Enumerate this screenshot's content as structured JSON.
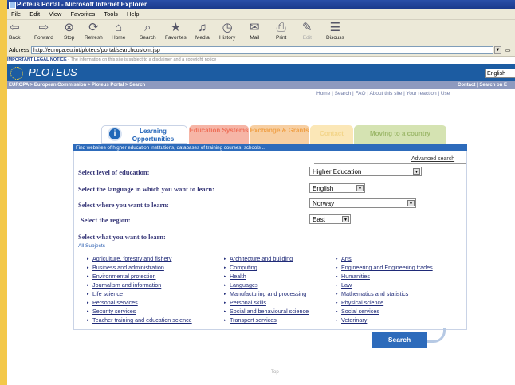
{
  "window": {
    "title": "Ploteus Portal - Microsoft Internet Explorer"
  },
  "menu": [
    "File",
    "Edit",
    "View",
    "Favorites",
    "Tools",
    "Help"
  ],
  "toolbar": [
    {
      "label": "Back",
      "icon": "back-arrow-icon",
      "glyph": "⇦"
    },
    {
      "label": "Forward",
      "icon": "forward-arrow-icon",
      "glyph": "⇨"
    },
    {
      "label": "Stop",
      "icon": "stop-icon",
      "glyph": "⊗"
    },
    {
      "label": "Refresh",
      "icon": "refresh-icon",
      "glyph": "⟳"
    },
    {
      "label": "Home",
      "icon": "home-icon",
      "glyph": "⌂"
    },
    {
      "label": "Search",
      "icon": "search-icon",
      "glyph": "⌕"
    },
    {
      "label": "Favorites",
      "icon": "favorites-icon",
      "glyph": "★"
    },
    {
      "label": "Media",
      "icon": "media-icon",
      "glyph": "♫"
    },
    {
      "label": "History",
      "icon": "history-icon",
      "glyph": "◷"
    },
    {
      "label": "Mail",
      "icon": "mail-icon",
      "glyph": "✉"
    },
    {
      "label": "Print",
      "icon": "print-icon",
      "glyph": "⎙"
    },
    {
      "label": "Edit",
      "icon": "edit-icon",
      "glyph": "✎"
    },
    {
      "label": "Discuss",
      "icon": "discuss-icon",
      "glyph": "☰"
    }
  ],
  "address": {
    "label": "Address",
    "url": "http://europa.eu.int/ploteus/portal/searchcustom.jsp"
  },
  "notice": {
    "bold": "IMPORTANT LEGAL NOTICE",
    "rest": " - The information on this site is subject to a disclaimer and a copyright notice"
  },
  "brand": {
    "name": "PLOTEUS",
    "language": "English"
  },
  "breadcrumb": {
    "path": "EUROPA > European Commission > Ploteus Portal > Search",
    "right": "Contact | Search on E"
  },
  "top_links": "Home | Search | FAQ | About this site | Your reaction | Use",
  "tabs": [
    {
      "label": "Learning Opportunities"
    },
    {
      "label": "Education Systems"
    },
    {
      "label": "Exchange & Grants"
    },
    {
      "label": "Contact"
    },
    {
      "label": "Moving to a country"
    }
  ],
  "info_bar": "Find websites of higher education institutions, databases of training courses, schools...",
  "advanced_search": "Advanced search",
  "questions": [
    {
      "label": "Select level of education:",
      "value": "Higher Education"
    },
    {
      "label": "Select the language in which you want to learn:",
      "value": "English"
    },
    {
      "label": "Select where you want to learn:",
      "value": "Norway"
    },
    {
      "label": "Select the region:",
      "value": "East"
    }
  ],
  "subjects_heading": "Select what you want to learn:",
  "all_subjects": "All Subjects",
  "subjects": [
    [
      "Agriculture, forestry and fishery",
      "Business and administration",
      "Environmental protection",
      "Journalism and information",
      "Life science",
      "Personal services",
      "Security services",
      "Teacher training and education science"
    ],
    [
      "Architecture and building",
      "Computing",
      "Health",
      "Languages",
      "Manufacturing and processing",
      "Personal skills",
      "Social and behavioural science",
      "Transport services"
    ],
    [
      "Arts",
      "Engineering and Engineering trades",
      "Humanities",
      "Law",
      "Mathematics and statistics",
      "Physical science",
      "Social services",
      "Veterinary"
    ]
  ],
  "search_button": "Search",
  "footer": "Top"
}
